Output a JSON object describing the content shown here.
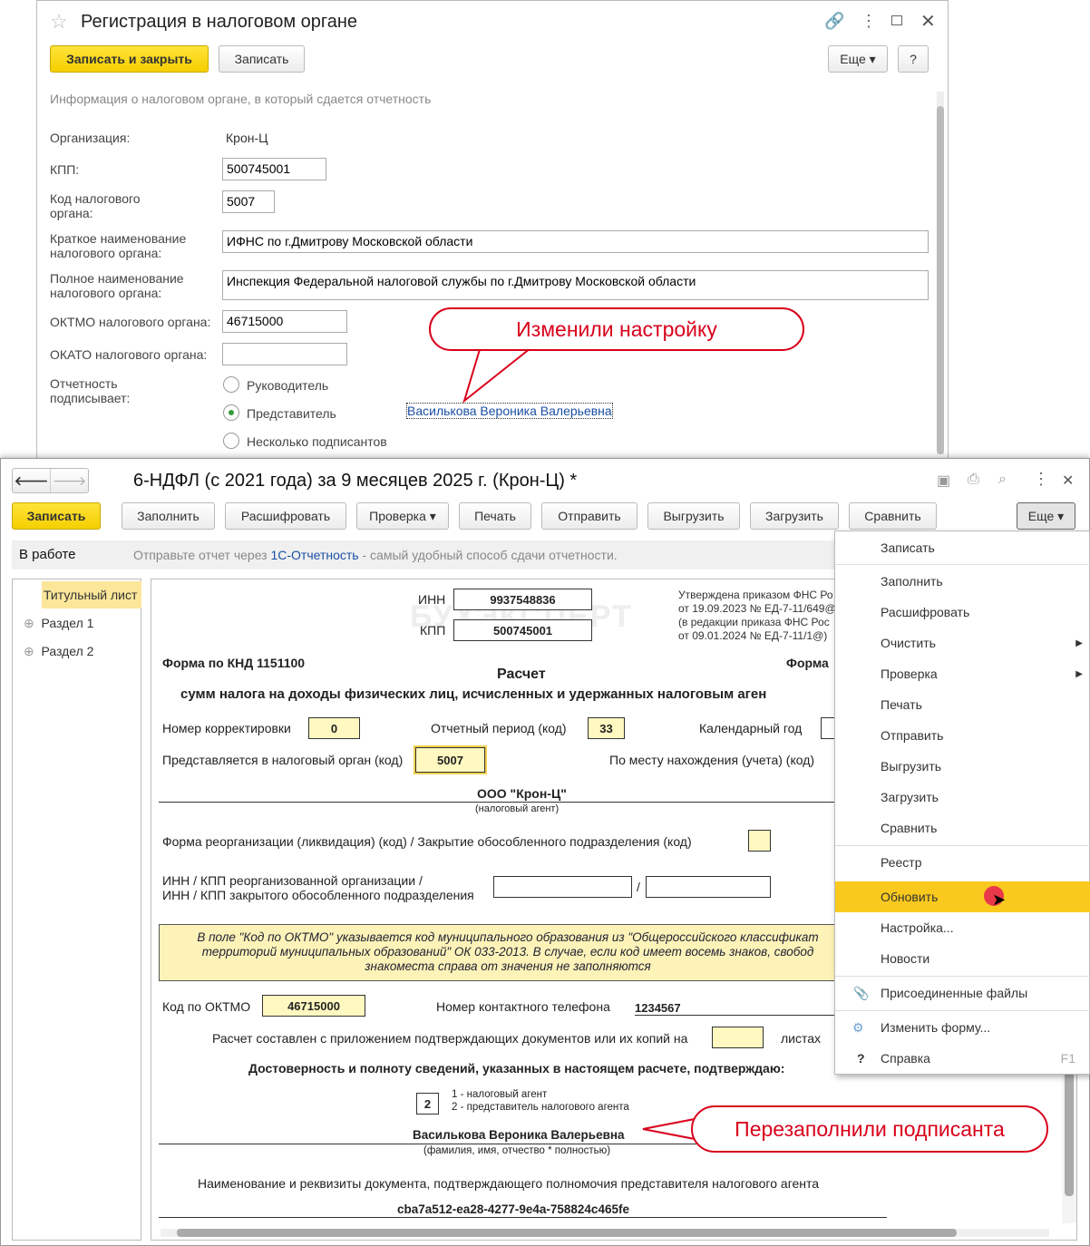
{
  "reg": {
    "title": "Регистрация в налоговом органе",
    "save_close": "Записать и закрыть",
    "save": "Записать",
    "more": "Еще",
    "help": "?",
    "info": "Информация о налоговом органе, в который сдается отчетность",
    "org_label": "Организация:",
    "org_value": "Крон-Ц",
    "kpp_label": "КПП:",
    "kpp_value": "500745001",
    "code_label": "Код налогового органа:",
    "code_value": "5007",
    "short_label": "Краткое наименование налогового органа:",
    "short_value": "ИФНС по г.Дмитрову Московской области",
    "full_label": "Полное наименование налогового органа:",
    "full_value": "Инспекция Федеральной налоговой службы по г.Дмитрову Московской области",
    "oktmo_label": "ОКТМО налогового органа:",
    "oktmo_value": "46715000",
    "okato_label": "ОКАТО налогового органа:",
    "okato_value": "",
    "signer_label": "Отчетность подписывает:",
    "signer_options": [
      "Руководитель",
      "Представитель",
      "Несколько подписантов"
    ],
    "signer_selected": 1,
    "representative": "Василькова Вероника Валерьевна"
  },
  "callouts": {
    "changed": "Изменили настройку",
    "refilled": "Перезаполнили подписанта"
  },
  "report": {
    "title": "6-НДФЛ (с 2021 года) за 9 месяцев 2025 г. (Крон-Ц) *",
    "toolbar": [
      "Заполнить",
      "Расшифровать",
      "Проверка",
      "Печать",
      "Отправить",
      "Выгрузить",
      "Загрузить",
      "Сравнить"
    ],
    "save": "Записать",
    "more": "Еще",
    "status": "В работе",
    "hint_pre": "Отправьте отчет через ",
    "hint_link": "1С-Отчетность",
    "hint_post": " - самый удобный способ сдачи отчетности.",
    "tree": [
      "Титульный лист",
      "Раздел 1",
      "Раздел 2"
    ],
    "form": {
      "inn_label": "ИНН",
      "inn": "9937548836",
      "kpp_label": "КПП",
      "kpp": "500745001",
      "approved": [
        "Утверждена приказом ФНС Ро",
        "от 19.09.2023 № ЕД-7-11/649@",
        "(в редакции приказа ФНС Рос",
        "от 09.01.2024 № ЕД-7-11/1@)"
      ],
      "knd": "Форма по КНД 1151100",
      "forma": "Форма",
      "title1": "Расчет",
      "title2": "сумм налога на доходы физических лиц, исчисленных и удержанных налоговым аген",
      "corr_label": "Номер корректировки",
      "corr": "0",
      "period_label": "Отчетный период (код)",
      "period": "33",
      "year_label": "Календарный год",
      "ifns_label": "Представляется в налоговый орган (код)",
      "ifns": "5007",
      "place_label": "По месту нахождения (учета) (код)",
      "agent": "ООО \"Крон-Ц\"",
      "agent_caption": "(налоговый агент)",
      "reorg_label": "Форма реорганизации (ликвидация) (код) / Закрытие обособленного подразделения (код)",
      "reorg_inn_label1": "ИНН / КПП реорганизованной организации /",
      "reorg_inn_label2": "ИНН / КПП закрытого обособленного подразделения",
      "slash": "/",
      "note": [
        "В поле \"Код по ОКТМО\" указывается код муниципального образования из \"Общероссийского классификат",
        "территорий муниципальных образований\" ОК 033-2013. В случае, если код имеет восемь знаков, свобод",
        "знакоместа справа от значения не заполняются"
      ],
      "oktmo_label": "Код по ОКТМО",
      "oktmo": "46715000",
      "phone_label": "Номер контактного телефона",
      "phone": "1234567",
      "docs_label": "Расчет составлен с приложением подтверждающих документов или их копий на",
      "docs_suffix": "листах",
      "confirm": "Достоверность и полноту сведений, указанных в настоящем расчете, подтверждаю:",
      "signer_code": "2",
      "signer_opt1": "1 - налоговый агент",
      "signer_opt2": "2 - представитель налогового агента",
      "signer_name": "Василькова Вероника Валерьевна",
      "signer_caption": "(фамилия, имя, отчество * полностью)",
      "doc_label": "Наименование и реквизиты документа, подтверждающего полномочия представителя налогового агента",
      "doc_value": "cba7a512-ea28-4277-9e4a-758824c465fe",
      "watermark": "БУХЭКСПЕРТ"
    }
  },
  "menu": {
    "items": [
      {
        "label": "Записать"
      },
      {
        "label": "Заполнить"
      },
      {
        "label": "Расшифровать"
      },
      {
        "label": "Очистить",
        "sub": true
      },
      {
        "label": "Проверка",
        "sub": true
      },
      {
        "label": "Печать"
      },
      {
        "label": "Отправить"
      },
      {
        "label": "Выгрузить"
      },
      {
        "label": "Загрузить"
      },
      {
        "label": "Сравнить"
      },
      {
        "label": "Реестр"
      },
      {
        "label": "Обновить",
        "active": true
      },
      {
        "label": "Настройка..."
      },
      {
        "label": "Новости"
      },
      {
        "label": "Присоединенные файлы"
      },
      {
        "label": "Изменить форму..."
      },
      {
        "label": "Справка",
        "shortcut": "F1"
      }
    ],
    "highlight": "#f9c91e"
  }
}
